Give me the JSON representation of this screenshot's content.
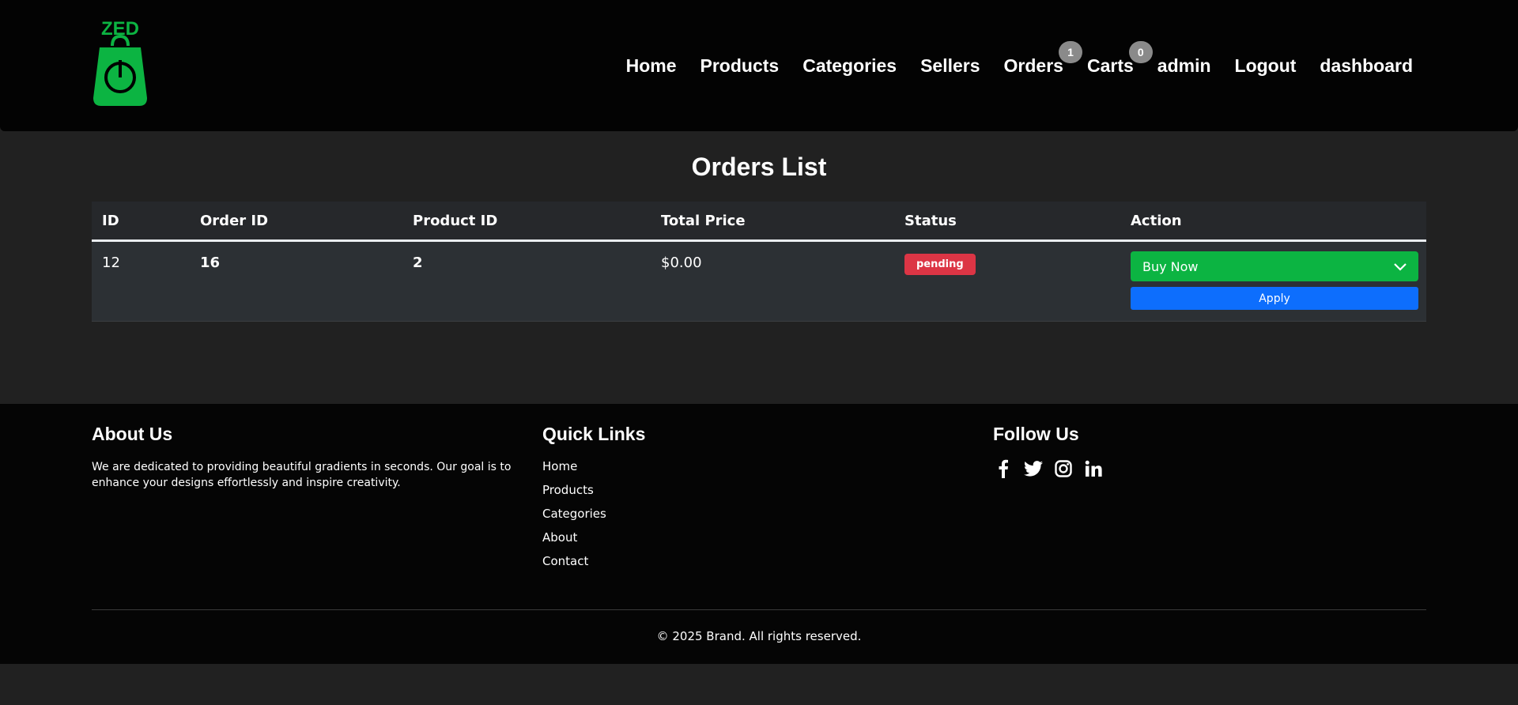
{
  "brand": {
    "logo_text": "ZED"
  },
  "nav": {
    "home": "Home",
    "products": "Products",
    "categories": "Categories",
    "sellers": "Sellers",
    "orders": "Orders",
    "orders_count": "1",
    "carts": "Carts",
    "carts_count": "0",
    "admin": "admin",
    "logout": "Logout",
    "dashboard": "dashboard"
  },
  "page": {
    "title": "Orders List"
  },
  "table": {
    "headers": [
      "ID",
      "Order ID",
      "Product ID",
      "Total Price",
      "Status",
      "Action"
    ],
    "rows": [
      {
        "id": "12",
        "order_id": "16",
        "product_id": "2",
        "total_price": "$0.00",
        "status": "pending",
        "action_selected": "Buy Now",
        "apply_label": "Apply"
      }
    ]
  },
  "footer": {
    "about_title": "About Us",
    "about_text": "We are dedicated to providing beautiful gradients in seconds. Our goal is to enhance your designs effortlessly and inspire creativity.",
    "links_title": "Quick Links",
    "links": [
      "Home",
      "Products",
      "Categories",
      "About",
      "Contact"
    ],
    "follow_title": "Follow Us",
    "social_icons": [
      "facebook-icon",
      "twitter-icon",
      "instagram-icon",
      "linkedin-icon"
    ],
    "copyright": "© 2025 Brand. All rights reserved."
  },
  "colors": {
    "brand_green": "#0cb442",
    "status_pending": "#dc3545",
    "apply_blue": "#0d6efd"
  }
}
